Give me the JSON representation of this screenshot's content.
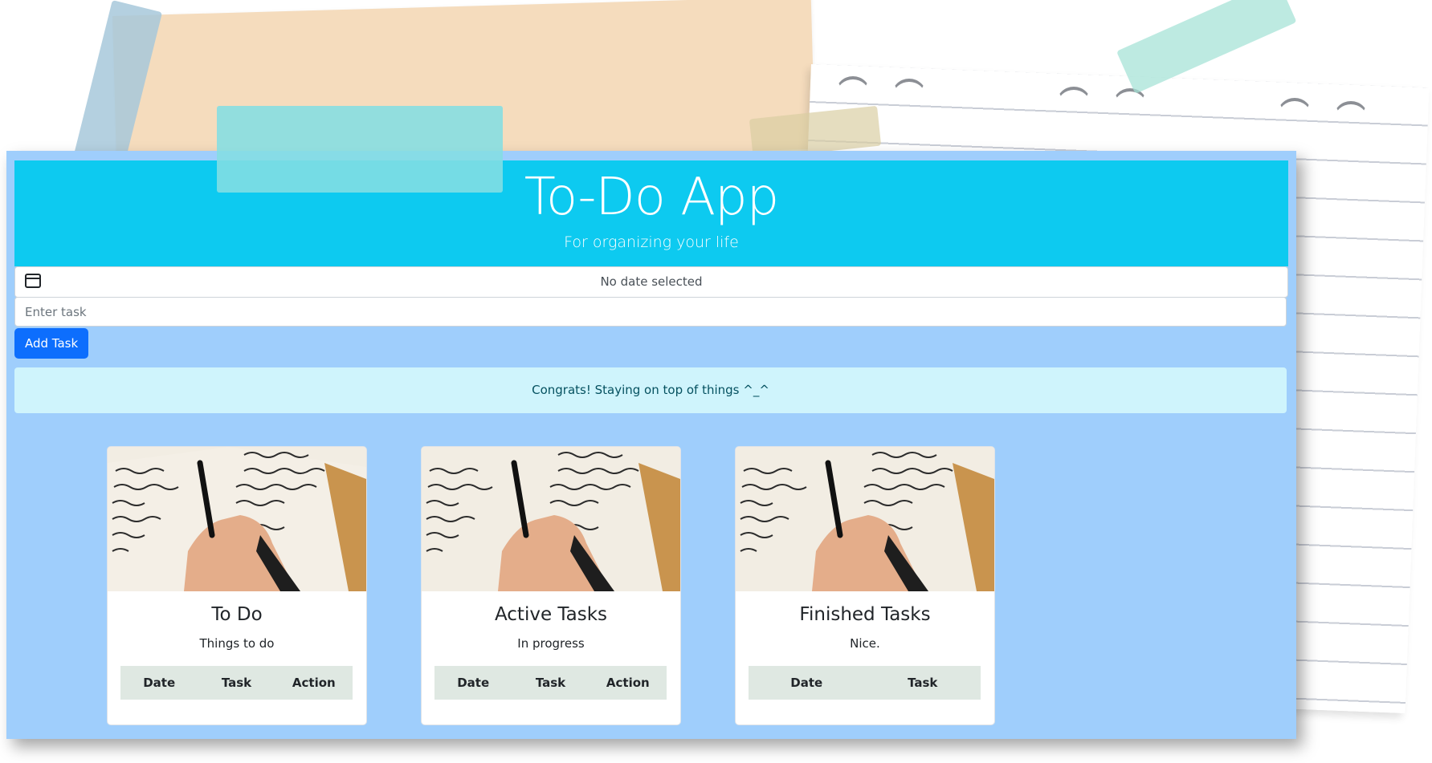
{
  "header": {
    "title": "To-Do App",
    "subtitle": "For organizing your life"
  },
  "date_picker": {
    "icon": "calendar-icon",
    "value": "No date selected"
  },
  "task_input": {
    "placeholder": "Enter task",
    "value": ""
  },
  "add_button": {
    "label": "Add Task"
  },
  "alert": {
    "text": "Congrats! Staying on top of things ^_^"
  },
  "cards": [
    {
      "title": "To Do",
      "text": "Things to do",
      "columns": [
        "Date",
        "Task",
        "Action"
      ]
    },
    {
      "title": "Active Tasks",
      "text": "In progress",
      "columns": [
        "Date",
        "Task",
        "Action"
      ]
    },
    {
      "title": "Finished Tasks",
      "text": "Nice.",
      "columns": [
        "Date",
        "Task"
      ]
    }
  ],
  "colors": {
    "header_bg": "#0dcaf0",
    "app_bg": "#9fcefc",
    "button_bg": "#0d6efd",
    "alert_bg": "#cff4fc",
    "alert_text": "#055160",
    "table_header_bg": "#dfe8e2"
  }
}
